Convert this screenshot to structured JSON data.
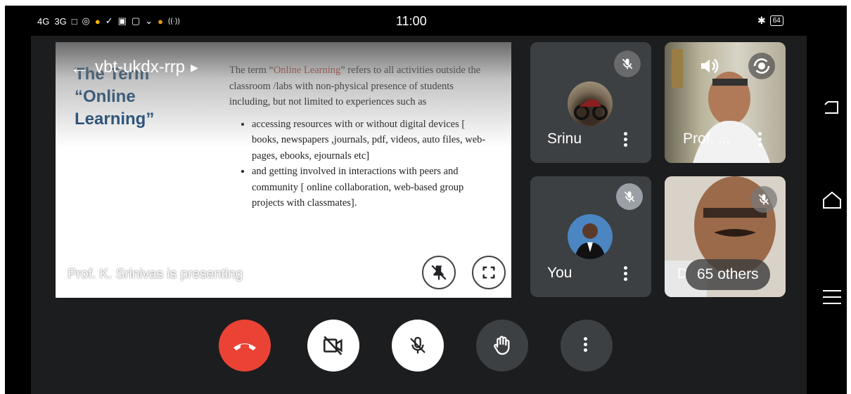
{
  "status_bar": {
    "left_text": [
      "4G",
      "3G",
      "□",
      "◎",
      "●",
      "✓",
      "▣",
      "▢",
      "⌄",
      "●",
      "((·))"
    ],
    "time": "11:00",
    "battery": "64"
  },
  "meeting": {
    "code": "vbt-ukdx-rrp",
    "presenting_text": "Prof. K. Srinivas is presenting"
  },
  "slide": {
    "title": "The Term “Online Learning”",
    "intro_before": "The term “",
    "intro_highlight": "Online Learning",
    "intro_after": "” refers to all activities outside the classroom /labs with non-physical presence of students including, but not limited to experiences such as",
    "bullets": [
      "accessing resources with or without digital devices [ books, newspapers ,journals, pdf, videos, auto files, web-pages, ebooks, ejournals etc]",
      "and getting involved in interactions with peers and community [ online collaboration, web-based group projects with classmates]."
    ]
  },
  "participants": {
    "srinu": {
      "name": "Srinu"
    },
    "prof": {
      "name": "Prof. ..."
    },
    "you": {
      "name": "You"
    },
    "others": {
      "label": "65 others",
      "partial_name": "Dr"
    }
  },
  "colors": {
    "end_call": "#ea4335",
    "slide_title": "#1f4e79",
    "highlight": "#c0392b",
    "tile": "#3c4043"
  }
}
